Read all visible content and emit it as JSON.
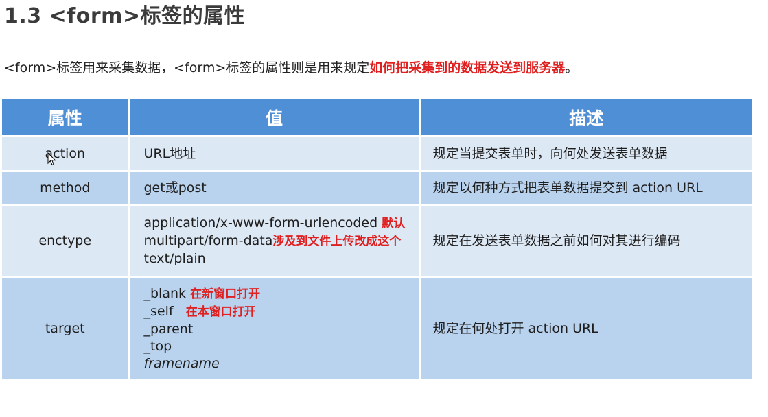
{
  "title": "1.3 <form>标签的属性",
  "intro": {
    "text": "<form>标签用来采集数据，<form>标签的属性则是用来规定",
    "highlight": "如何把采集到的数据发送到服务器",
    "end": "。"
  },
  "table": {
    "headers": [
      "属性",
      "值",
      "描述"
    ],
    "rows": [
      {
        "attr": "action",
        "values": [
          {
            "text": "URL地址",
            "note": ""
          }
        ],
        "desc": "规定当提交表单时，向何处发送表单数据"
      },
      {
        "attr": "method",
        "values": [
          {
            "text": "get或post",
            "note": ""
          }
        ],
        "desc": "规定以何种方式把表单数据提交到 action URL"
      },
      {
        "attr": "enctype",
        "values": [
          {
            "text": "application/x-www-form-urlencoded",
            "note": "默认"
          },
          {
            "text": "multipart/form-data",
            "note": "涉及到文件上传改成这个"
          },
          {
            "text": "text/plain",
            "note": ""
          }
        ],
        "desc": "规定在发送表单数据之前如何对其进行编码"
      },
      {
        "attr": "target",
        "values": [
          {
            "text": "_blank",
            "note": "在新窗口打开"
          },
          {
            "text": "_self",
            "note": "在本窗口打开"
          },
          {
            "text": "_parent",
            "note": ""
          },
          {
            "text": "_top",
            "note": ""
          },
          {
            "text": "framename",
            "note": ""
          }
        ],
        "desc": "规定在何处打开 action URL"
      }
    ]
  },
  "colors": {
    "header_bg": "#4f8fd6",
    "row_light": "#dde8f5",
    "row_dark": "#b9d3ef",
    "highlight": "#e02020"
  },
  "icons": {
    "cursor": "mouse-pointer-icon"
  }
}
